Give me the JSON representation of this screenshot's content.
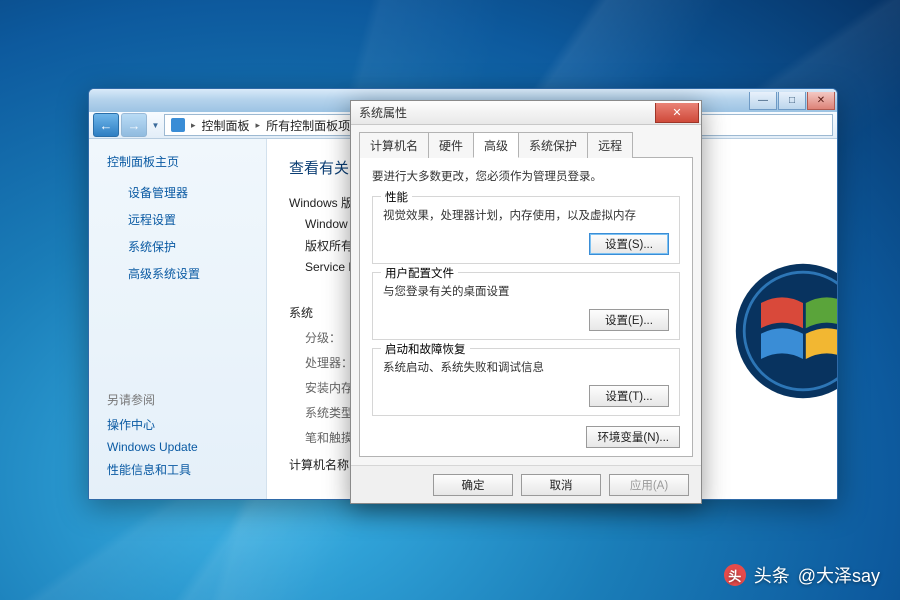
{
  "cp": {
    "breadcrumb": {
      "seg1": "控制面板",
      "seg2": "所有控制面板项"
    },
    "sidebar": {
      "title": "控制面板主页",
      "items": [
        {
          "label": "设备管理器"
        },
        {
          "label": "远程设置"
        },
        {
          "label": "系统保护"
        },
        {
          "label": "高级系统设置"
        }
      ],
      "related_title": "另请参阅",
      "related": [
        {
          "label": "操作中心"
        },
        {
          "label": "Windows Update"
        },
        {
          "label": "性能信息和工具"
        }
      ]
    },
    "main": {
      "heading": "查看有关",
      "winver_label": "Windows 版",
      "winver_line": "Window",
      "copyright_label": "版权所有",
      "sp_label": "Service P",
      "system_heading": "系统",
      "rating_label": "分级：",
      "cpu_label": "处理器：",
      "mem_label": "安装内存",
      "systype_label": "系统类型",
      "pen_label": "笔和触摸",
      "compname_label": "计算机名称"
    }
  },
  "sp": {
    "title": "系统属性",
    "tabs": [
      {
        "label": "计算机名"
      },
      {
        "label": "硬件"
      },
      {
        "label": "高级"
      },
      {
        "label": "系统保护"
      },
      {
        "label": "远程"
      }
    ],
    "active_tab_index": 2,
    "admin_hint": "要进行大多数更改，您必须作为管理员登录。",
    "groups": {
      "perf": {
        "title": "性能",
        "desc": "视觉效果，处理器计划，内存使用，以及虚拟内存",
        "btn": "设置(S)..."
      },
      "profile": {
        "title": "用户配置文件",
        "desc": "与您登录有关的桌面设置",
        "btn": "设置(E)..."
      },
      "startup": {
        "title": "启动和故障恢复",
        "desc": "系统启动、系统失败和调试信息",
        "btn": "设置(T)..."
      }
    },
    "env_btn": "环境变量(N)...",
    "footer": {
      "ok": "确定",
      "cancel": "取消",
      "apply": "应用(A)"
    }
  },
  "watermark": {
    "prefix": "头条",
    "handle": "@大泽say"
  }
}
